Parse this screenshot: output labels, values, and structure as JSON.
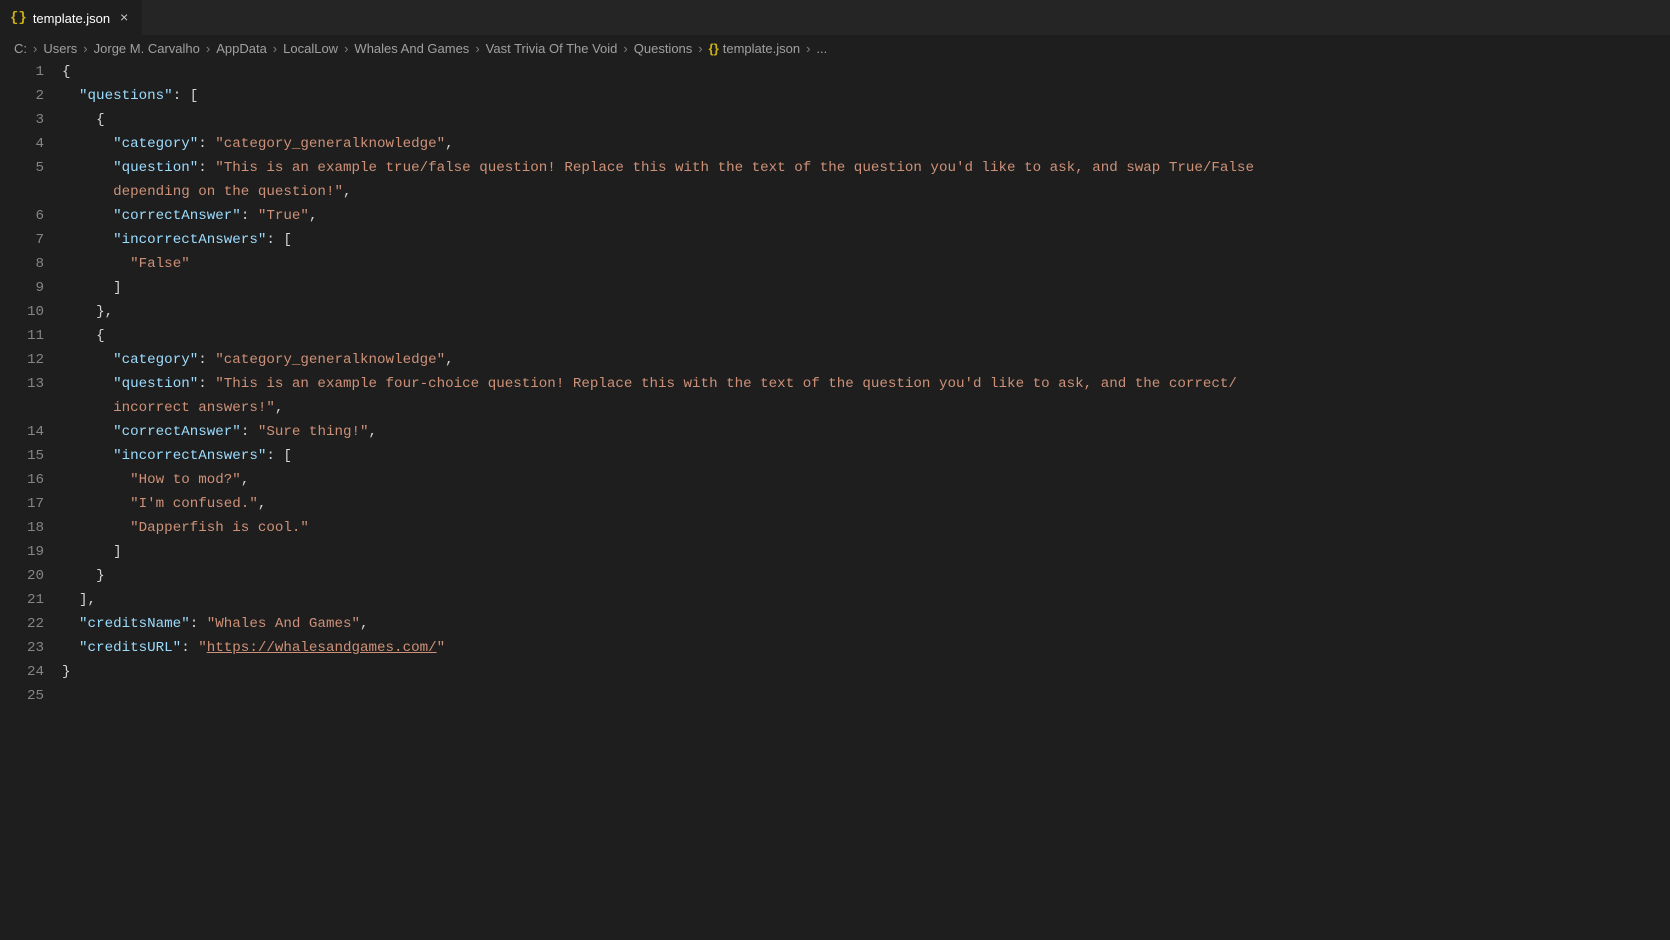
{
  "tab": {
    "icon": "{}",
    "label": "template.json",
    "close": "×"
  },
  "breadcrumb": {
    "parts": [
      "C:",
      "Users",
      "Jorge M. Carvalho",
      "AppData",
      "LocalLow",
      "Whales And Games",
      "Vast Trivia Of The Void",
      "Questions"
    ],
    "fileIcon": "{}",
    "file": "template.json",
    "tail": "..."
  },
  "lineCount": 25,
  "code": {
    "l1": "{",
    "l2_key": "\"questions\"",
    "l2_after": ": [",
    "l3": "{",
    "l4_key": "\"category\"",
    "l4_val": "\"category_generalknowledge\"",
    "l5_key": "\"question\"",
    "l5_val": "\"This is an example true/false question! Replace this with the text of the question you'd like to ask, and swap True/False ",
    "l5b_val": "depending on the question!\"",
    "l6_key": "\"correctAnswer\"",
    "l6_val": "\"True\"",
    "l7_key": "\"incorrectAnswers\"",
    "l7_after": ": [",
    "l8_val": "\"False\"",
    "l9": "]",
    "l10": "},",
    "l11": "{",
    "l12_key": "\"category\"",
    "l12_val": "\"category_generalknowledge\"",
    "l13_key": "\"question\"",
    "l13_val": "\"This is an example four-choice question! Replace this with the text of the question you'd like to ask, and the correct/",
    "l13b_val": "incorrect answers!\"",
    "l14_key": "\"correctAnswer\"",
    "l14_val": "\"Sure thing!\"",
    "l15_key": "\"incorrectAnswers\"",
    "l15_after": ": [",
    "l16_val": "\"How to mod?\"",
    "l17_val": "\"I'm confused.\"",
    "l18_val": "\"Dapperfish is cool.\"",
    "l19": "]",
    "l20": "}",
    "l21": "],",
    "l22_key": "\"creditsName\"",
    "l22_val": "\"Whales And Games\"",
    "l23_key": "\"creditsURL\"",
    "l23_q": "\"",
    "l23_link": "https://whalesandgames.com/",
    "l23_qe": "\"",
    "l24": "}"
  }
}
